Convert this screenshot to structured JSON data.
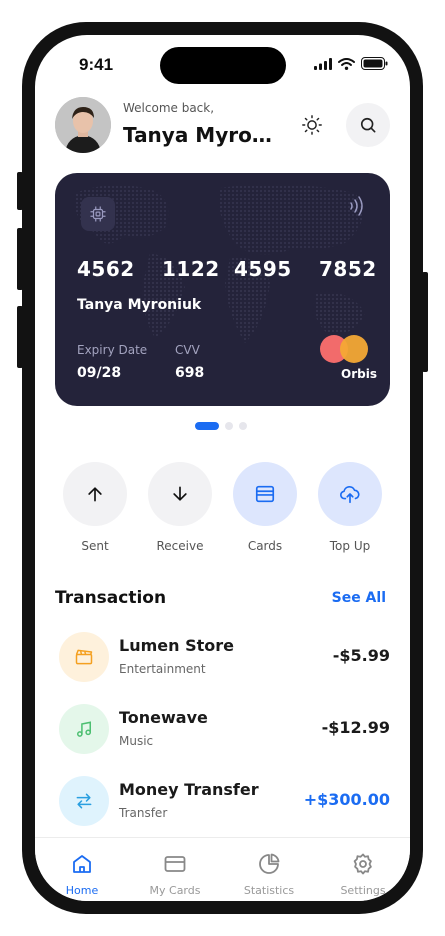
{
  "status_bar": {
    "time": "9:41"
  },
  "header": {
    "welcome": "Welcome back,",
    "name": "Tanya Myroniuk"
  },
  "card": {
    "number_groups": [
      "4562",
      "1122",
      "4595",
      "7852"
    ],
    "holder": "Tanya Myroniuk",
    "expiry_label": "Expiry Date",
    "expiry_value": "09/28",
    "cvv_label": "CVV",
    "cvv_value": "698",
    "brand": "Orbis"
  },
  "actions": [
    {
      "label": "Sent",
      "icon": "arrow-up-icon"
    },
    {
      "label": "Receive",
      "icon": "arrow-down-icon"
    },
    {
      "label": "Cards",
      "icon": "wallet-icon"
    },
    {
      "label": "Top Up",
      "icon": "cloud-upload-icon"
    }
  ],
  "transactions": {
    "title": "Transaction",
    "see_all": "See All",
    "items": [
      {
        "name": "Lumen Store",
        "category": "Entertainment",
        "amount": "-$5.99",
        "icon": "clapperboard-icon"
      },
      {
        "name": "Tonewave",
        "category": "Music",
        "amount": "-$12.99",
        "icon": "music-note-icon"
      },
      {
        "name": "Money Transfer",
        "category": "Transfer",
        "amount": "+$300.00",
        "icon": "transfer-arrows-icon"
      }
    ]
  },
  "nav": [
    {
      "label": "Home",
      "active": true
    },
    {
      "label": "My Cards",
      "active": false
    },
    {
      "label": "Statistics",
      "active": false
    },
    {
      "label": "Settings",
      "active": false
    }
  ],
  "colors": {
    "accent": "#1b6cf2",
    "card_bg": "#24233a",
    "frame": "#121212"
  }
}
